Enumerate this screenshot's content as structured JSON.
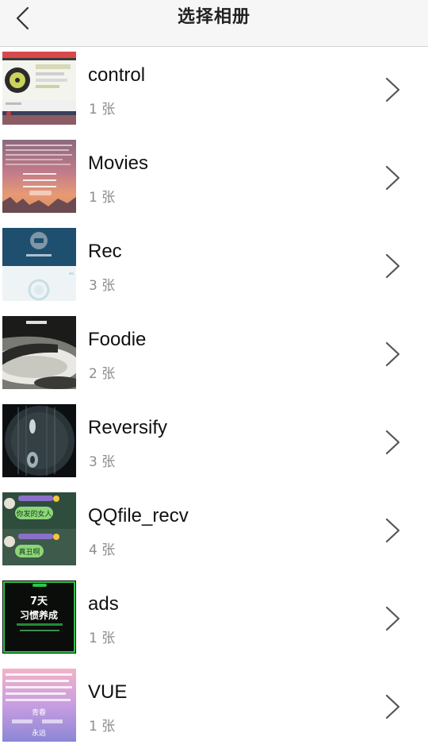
{
  "header": {
    "title": "选择相册",
    "back_icon": "chevron-left-icon"
  },
  "albums": [
    {
      "name": "control",
      "count": "1 张"
    },
    {
      "name": "Movies",
      "count": "1 张"
    },
    {
      "name": "Rec",
      "count": "3 张"
    },
    {
      "name": "Foodie",
      "count": "2 张"
    },
    {
      "name": "Reversify",
      "count": "3 张"
    },
    {
      "name": "QQfile_recv",
      "count": "4 张",
      "thumb_text": [
        "你发的女人",
        "真丑啊"
      ]
    },
    {
      "name": "ads",
      "count": "1 张",
      "thumb_text": [
        "7天",
        "习惯养成"
      ]
    },
    {
      "name": "VUE",
      "count": "1 张",
      "thumb_text": [
        "青春",
        "永远"
      ]
    }
  ],
  "colors": {
    "header_bg": "#f6f6f6",
    "text": "#111111",
    "secondary": "#8c8c8c",
    "chevron": "#555555"
  }
}
